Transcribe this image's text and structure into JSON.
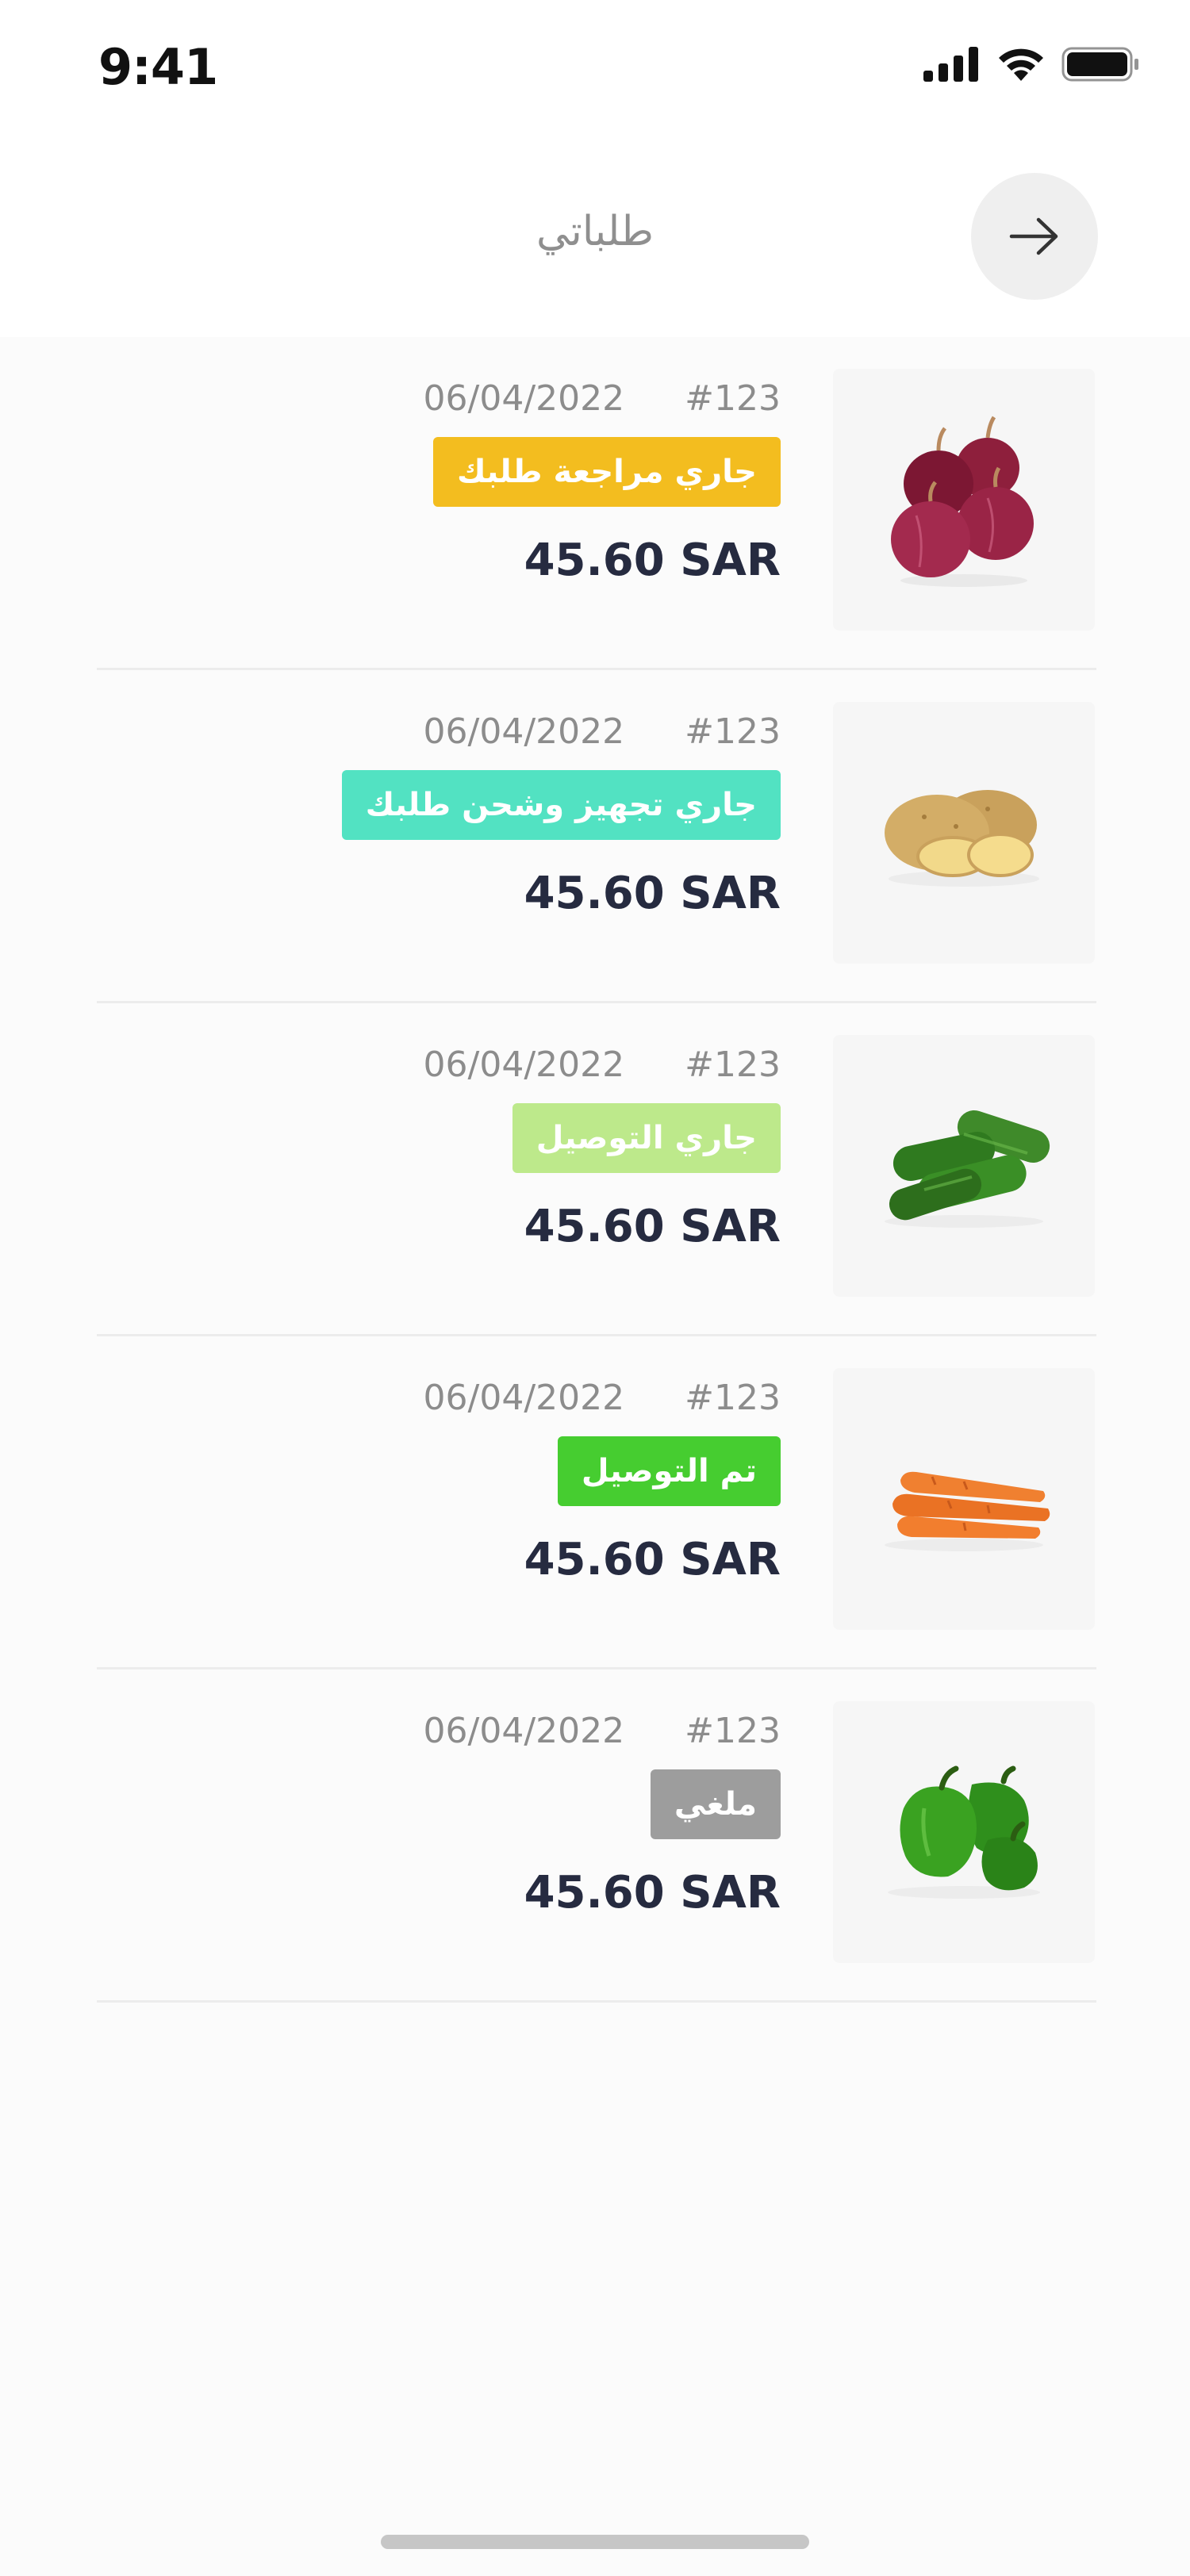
{
  "status_bar": {
    "time": "9:41"
  },
  "header": {
    "title": "طلباتي",
    "back_icon": "arrow-right-icon"
  },
  "orders": [
    {
      "id": "#123",
      "date": "06/04/2022",
      "status": "جاري مراجعة طلبك",
      "status_color": "#f3bd1f",
      "price": "45.60 SAR",
      "product_icon": "red-onion-image"
    },
    {
      "id": "#123",
      "date": "06/04/2022",
      "status": "جاري تجهيز وشحن طلبك",
      "status_color": "#52e2c2",
      "price": "45.60 SAR",
      "product_icon": "potato-image"
    },
    {
      "id": "#123",
      "date": "06/04/2022",
      "status": "جاري التوصيل",
      "status_color": "#bde98b",
      "price": "45.60 SAR",
      "product_icon": "cucumber-image"
    },
    {
      "id": "#123",
      "date": "06/04/2022",
      "status": "تم التوصيل",
      "status_color": "#46cd30",
      "price": "45.60 SAR",
      "product_icon": "carrot-image"
    },
    {
      "id": "#123",
      "date": "06/04/2022",
      "status": "ملغي",
      "status_color": "#9d9d9d",
      "price": "45.60 SAR",
      "product_icon": "green-pepper-image"
    }
  ]
}
